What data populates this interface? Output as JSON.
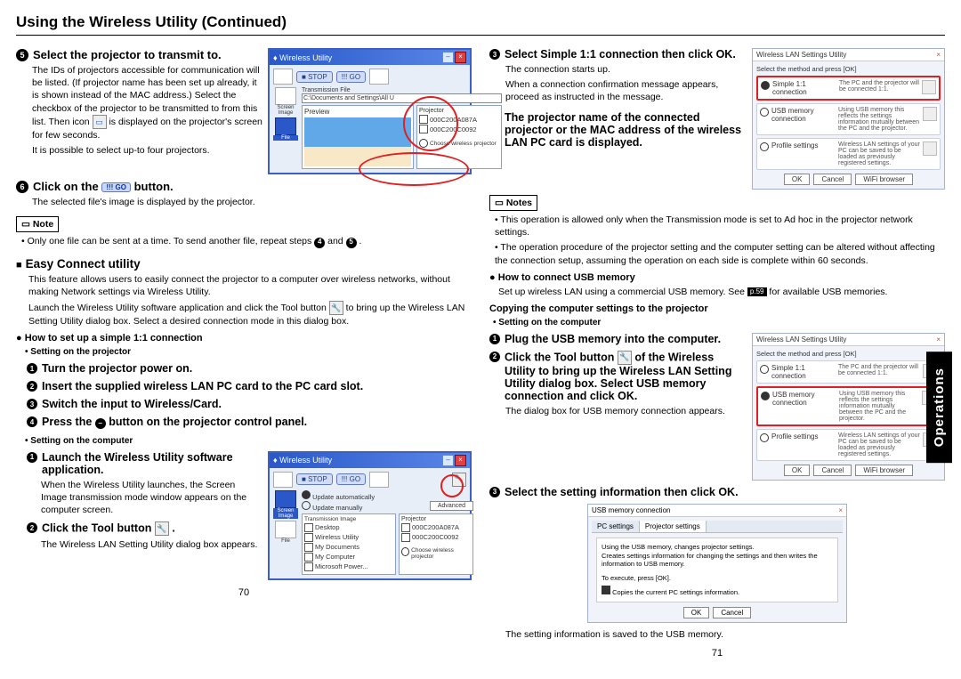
{
  "title": "Using the Wireless Utility (Continued)",
  "sideTab": "Operations",
  "left": {
    "step5_head": "Select the projector to transmit to.",
    "step5_body1": "The IDs of projectors accessible for communication will be listed. (If projector name has been set up already, it is shown instead of the MAC address.) Select the checkbox of the projector to be transmitted to from this list. Then icon",
    "step5_body1b": "is displayed on the projector's screen for few seconds.",
    "step5_body2": "It is possible to select up-to four projectors.",
    "step6_head_a": "Click on the",
    "step6_head_b": "button.",
    "step6_body": "The selected file's image is displayed by the projector.",
    "note_label": "Note",
    "note_text_a": "Only one file can be sent at a time. To send another file, repeat steps",
    "note_and": "and",
    "note_text_b": ".",
    "easy_head": "Easy Connect utility",
    "easy_body": "This feature allows users to easily connect the projector to a computer over wireless networks, without making Network settings via Wireless Utility.",
    "easy_body2a": "Launch the Wireless Utility software application and click the Tool button",
    "easy_body2b": "to bring up the Wireless LAN Setting Utility dialog box. Select a desired connection mode in this dialog box.",
    "howto_head": "How to set up a simple 1:1 connection",
    "proj_setting": "Setting on the projector",
    "p1": "Turn the projector power on.",
    "p2": "Insert the supplied wireless LAN PC card to the PC card slot.",
    "p3": "Switch the input to Wireless/Card.",
    "p4a": "Press the",
    "p4b": "button on the projector control panel.",
    "comp_setting": "Setting on the computer",
    "c1": "Launch the Wireless Utility software application.",
    "c1_body": "When the Wireless Utility launches, the Screen Image transmission mode window appears on the computer screen.",
    "c2": "Click the Tool button",
    "c2_body": "The Wireless LAN Setting Utility dialog box appears.",
    "go_label": "!!! GO",
    "pageNum": "70"
  },
  "right": {
    "s3_head": "Select Simple 1:1 connection then click OK.",
    "s3_b1": "The connection starts up.",
    "s3_b2": "When a connection confirmation message appears, proceed as instructed in the message.",
    "s4_head": "The projector name of the connected projector or the MAC address of the wireless LAN PC card is displayed.",
    "notes_label": "Notes",
    "notes_1": "This operation is allowed only when the Transmission mode is set to Ad hoc in the projector network settings.",
    "notes_2": "The operation procedure of the projector setting and the computer setting can be altered without affecting the connection setup, assuming the operation on each side is complete within 60 seconds.",
    "usb_head": "How to connect USB memory",
    "usb_body_a": "Set up wireless LAN using a commercial USB memory. See",
    "usb_pref": "p.59",
    "usb_body_b": "for available USB memories.",
    "copy_head": "Copying the computer settings to the projector",
    "comp_setting": "Setting on the computer",
    "u1": "Plug the USB memory into the computer.",
    "u2_a": "Click the Tool button",
    "u2_b": "of the Wireless Utility to bring up the Wireless LAN Setting Utility dialog box. Select USB memory connection and click OK.",
    "u2_body": "The dialog box for USB memory connection appears.",
    "u3": "Select the setting information then click OK.",
    "u_final": "The setting information is saved to the USB memory.",
    "pageNum": "71"
  },
  "fig1": {
    "title": "Wireless Utility",
    "stop": "STOP",
    "go": "!!! GO",
    "screenImage": "Screen Image",
    "file": "File",
    "transFile": "Transmission File",
    "path": "C:\\Documents and Settings\\All U",
    "preview": "Preview",
    "projector": "Projector",
    "row1": "000C200A087A",
    "row2": "000C200C0092",
    "choose": "Choose wireless projector"
  },
  "fig2": {
    "title": "Wireless Utility",
    "opt1": "Update automatically",
    "opt2": "Update manually",
    "advanced": "Advanced",
    "transImage": "Transmission Image",
    "items": [
      "Desktop",
      "Wireless Utility",
      "My Documents",
      "My Computer",
      "Microsoft Power..."
    ]
  },
  "dlg": {
    "title": "Wireless LAN Settings Utility",
    "intro": "Select the method and press [OK]",
    "opt1_label": "Simple 1:1 connection",
    "opt1_desc": "The PC and the projector will be connected 1:1.",
    "opt2_label": "USB memory connection",
    "opt2_desc": "Using USB memory this reflects the settings information mutually between the PC and the projector.",
    "opt3_label": "Profile settings",
    "opt3_desc": "Wireless LAN settings of your PC can be saved to be loaded as previously registered settings.",
    "ok": "OK",
    "cancel": "Cancel",
    "wifi": "WiFi browser"
  },
  "usbdlg": {
    "title": "USB memory connection",
    "tab1": "PC settings",
    "tab2": "Projector settings",
    "line1": "Using the USB memory, changes projector settings.",
    "line2": "Creates settings information for changing the settings and then writes the information to USB memory.",
    "line3": "To execute, press [OK].",
    "chk": "Copies the current PC settings information.",
    "ok": "OK",
    "cancel": "Cancel"
  }
}
